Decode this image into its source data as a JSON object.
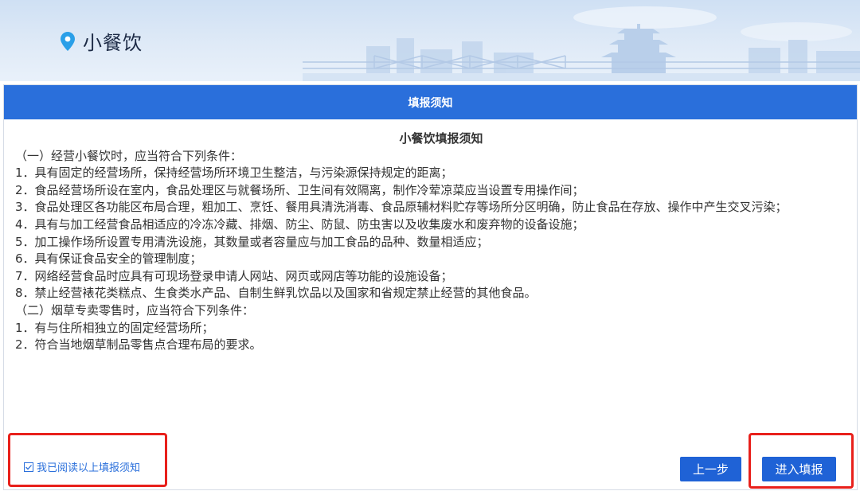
{
  "header": {
    "title": "小餐饮",
    "icon": "location-pin-icon",
    "accent": "#2a9fe8"
  },
  "panel": {
    "heading": "填报须知",
    "heading_bg": "#2a6fdb",
    "notice_title": "小餐饮填报须知",
    "lines": [
      "（一）经营小餐饮时，应当符合下列条件：",
      "1．具有固定的经营场所，保持经营场所环境卫生整洁，与污染源保持规定的距离；",
      "2．食品经营场所设在室内，食品处理区与就餐场所、卫生间有效隔离，制作冷荤凉菜应当设置专用操作间；",
      "3．食品处理区各功能区布局合理，粗加工、烹饪、餐用具清洗消毒、食品原辅材料贮存等场所分区明确，防止食品在存放、操作中产生交叉污染；",
      "4．具有与加工经营食品相适应的冷冻冷藏、排烟、防尘、防鼠、防虫害以及收集废水和废弃物的设备设施；",
      "5．加工操作场所设置专用清洗设施，其数量或者容量应与加工食品的品种、数量相适应；",
      "6．具有保证食品安全的管理制度；",
      "7．网络经营食品时应具有可现场登录申请人网站、网页或网店等功能的设施设备；",
      "8．禁止经营裱花类糕点、生食类水产品、自制生鲜乳饮品以及国家和省规定禁止经营的其他食品。",
      "（二）烟草专卖零售时，应当符合下列条件：",
      "1．有与住所相独立的固定经营场所；",
      "2．符合当地烟草制品零售点合理布局的要求。"
    ]
  },
  "footer": {
    "agree_label": "我已阅读以上填报须知",
    "agree_icon": "checkbox-icon",
    "prev_label": "上一步",
    "enter_label": "进入填报",
    "button_color": "#1f62d6",
    "highlight_color": "#e8201b"
  }
}
